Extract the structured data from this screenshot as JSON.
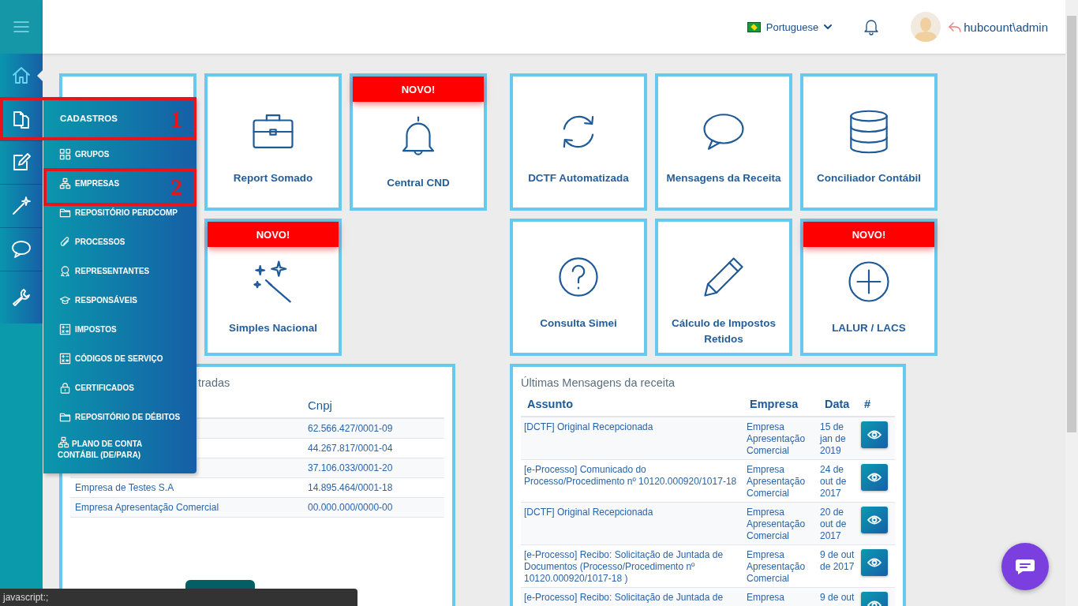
{
  "header": {
    "language": "Portuguese",
    "user": "hubcount\\admin"
  },
  "sidebar": {
    "items": [
      {
        "kind": "home",
        "selected": true
      },
      {
        "kind": "documents",
        "selected": false
      },
      {
        "kind": "edit",
        "selected": false
      },
      {
        "kind": "wand",
        "selected": false
      },
      {
        "kind": "chat",
        "selected": false
      },
      {
        "kind": "wrench",
        "selected": false
      }
    ]
  },
  "menu": {
    "title": "CADASTROS",
    "items": [
      {
        "label": "GRUPOS",
        "kind": "grid"
      },
      {
        "label": "EMPRESAS",
        "kind": "hierarchy"
      },
      {
        "label": "REPOSITÓRIO PERDCOMP",
        "kind": "folder"
      },
      {
        "label": "PROCESSOS",
        "kind": "paperclip"
      },
      {
        "label": "REPRESENTANTES",
        "kind": "award"
      },
      {
        "label": "RESPONSÁVEIS",
        "kind": "cap"
      },
      {
        "label": "IMPOSTOS",
        "kind": "calc"
      },
      {
        "label": "CÓDIGOS DE SERVIÇO",
        "kind": "calc"
      },
      {
        "label": "CERTIFICADOS",
        "kind": "lock"
      },
      {
        "label": "REPOSITÓRIO DE DÉBITOS",
        "kind": "folder"
      },
      {
        "label": "PLANO DE CONTA CONTÁBIL (DE/PARA)",
        "kind": "hierarchy"
      }
    ]
  },
  "annotations": [
    {
      "label": "1"
    },
    {
      "label": "2"
    }
  ],
  "tile_rows": [
    {
      "left": [
        {
          "kind": "blank"
        },
        {
          "kind": "briefcase",
          "label": "Report Somado"
        },
        {
          "kind": "bell",
          "label": "Central CND",
          "badge": "NOVO!"
        }
      ],
      "right": [
        {
          "kind": "sync",
          "label": "DCTF Automatizada"
        },
        {
          "kind": "bubble",
          "label": "Mensagens da Receita"
        },
        {
          "kind": "database",
          "label": "Conciliador Contábil"
        }
      ]
    },
    {
      "left": [
        {
          "kind": "wand",
          "label": "Simples Nacional",
          "badge": "NOVO!"
        }
      ],
      "right": [
        {
          "kind": "question",
          "label": "Consulta Simei"
        },
        {
          "kind": "pencil",
          "label": "Cálculo de Impostos Retidos"
        },
        {
          "kind": "plus",
          "label": "LALUR / LACS",
          "badge": "NOVO!"
        }
      ]
    }
  ],
  "companies_panel": {
    "title": "tradas",
    "columns": [
      "Cnpj"
    ],
    "rows": [
      {
        "cnpj": "62.566.427/0001-09"
      },
      {
        "cnpj": "44.267.817/0001-04"
      },
      {
        "cnpj": "37.106.033/0001-20"
      },
      {
        "name": "Empresa de Testes S.A",
        "cnpj": "14.895.464/0001-18"
      },
      {
        "name": "Empresa Apresentação Comercial",
        "cnpj": "00.000.000/0000-00"
      }
    ]
  },
  "messages_panel": {
    "title": "Últimas Mensagens da receita",
    "columns": [
      "Assunto",
      "Empresa",
      "Data",
      "#"
    ],
    "rows": [
      {
        "subject": "[DCTF] Original Recepcionada",
        "company": "Empresa Apresentação Comercial",
        "date": "15 de jan de 2019"
      },
      {
        "subject": "[e-Processo] Comunicado do Processo/Procedimento nº 10120.000920/1017-18",
        "company": "Empresa Apresentação Comercial",
        "date": "24 de out de 2017"
      },
      {
        "subject": "[DCTF] Original Recepcionada",
        "company": "Empresa Apresentação Comercial",
        "date": "20 de out de 2017"
      },
      {
        "subject": "[e-Processo] Recibo: Solicitação de Juntada de Documentos (Processo/Procedimento nº 10120.000920/1017-18 )",
        "company": "Empresa Apresentação Comercial",
        "date": "9 de out de 2017"
      },
      {
        "subject": "[e-Processo] Recibo: Solicitação de Juntada de",
        "company": "Empresa",
        "date": "9 de out"
      }
    ]
  },
  "status_bar": {
    "text": "javascript:;"
  }
}
